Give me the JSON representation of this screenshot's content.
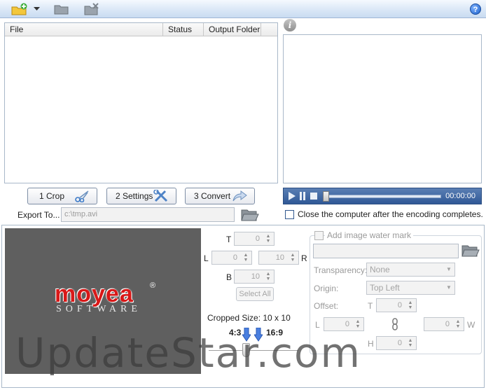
{
  "toolbar": {
    "icons": [
      "add-file-icon",
      "dropdown-arrow-icon",
      "folder-icon",
      "remove-icon",
      "help-icon"
    ],
    "help_label": "?"
  },
  "file_list": {
    "columns": [
      "File",
      "Status",
      "Output Folder"
    ]
  },
  "preview": {
    "info_label": "i"
  },
  "actions": {
    "crop_label": "1 Crop",
    "settings_label": "2 Settings",
    "convert_label": "3 Convert"
  },
  "player": {
    "time": "00:00:00",
    "progress": 0.0
  },
  "export": {
    "label": "Export To...",
    "path": "c:\\tmp.avi"
  },
  "close_after": {
    "label": "Close the computer after the encoding completes.",
    "checked": false
  },
  "logo": {
    "text": "moyea",
    "registered": "®",
    "sub": "SOFTWARE"
  },
  "crop": {
    "t_label": "T",
    "l_label": "L",
    "r_label": "R",
    "b_label": "B",
    "t_value": "0",
    "l_value": "0",
    "r_value": "10",
    "b_value": "10",
    "select_all_label": "Select All",
    "cropped_size_label": "Cropped Size: 10 x 10",
    "ratio_left": "4:3",
    "ratio_right": "16:9"
  },
  "watermark_settings": {
    "add_label": "Add image water mark",
    "transparency_label": "Transparency:",
    "transparency_value": "None",
    "origin_label": "Origin:",
    "origin_value": "Top Left",
    "offset_label": "Offset:",
    "t_label": "T",
    "l_label": "L",
    "w_label": "W",
    "h_label": "H",
    "t_value": "0",
    "l_value": "0",
    "w_value": "0",
    "h_value": "0"
  },
  "overlay_watermark": "UpdateStar.com"
}
